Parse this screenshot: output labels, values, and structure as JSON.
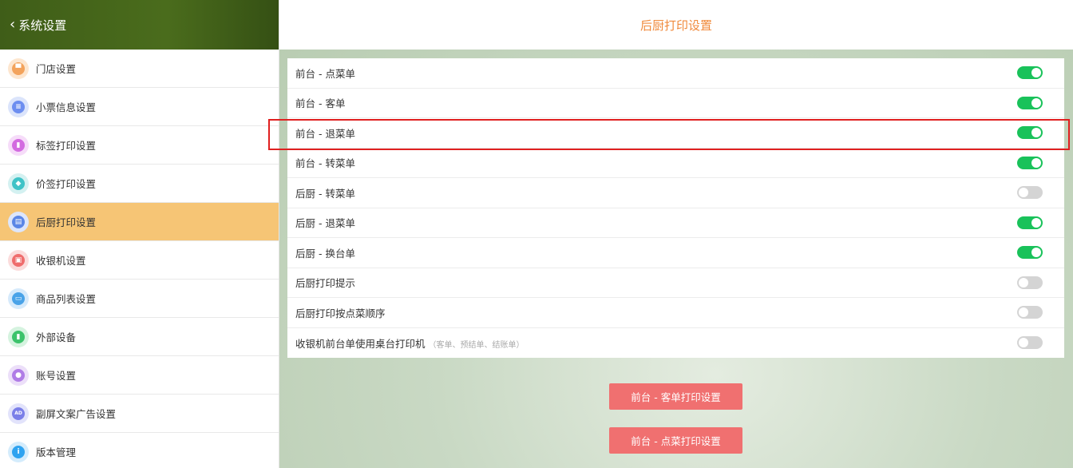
{
  "sidebar": {
    "title": "系统设置",
    "items": [
      {
        "label": "门店设置",
        "icon": "store-icon",
        "color": "#f3a35c",
        "bg": "#fde6cf"
      },
      {
        "label": "小票信息设置",
        "icon": "receipt-icon",
        "color": "#6d8ef0",
        "bg": "#dbe4fb"
      },
      {
        "label": "标签打印设置",
        "icon": "bookmark-icon",
        "color": "#d36be0",
        "bg": "#f6dcf9"
      },
      {
        "label": "价签打印设置",
        "icon": "price-tag-icon",
        "color": "#3ec3c7",
        "bg": "#d4f1f1"
      },
      {
        "label": "后厨打印设置",
        "icon": "printer-icon",
        "color": "#5b86e6",
        "bg": "#dde6fb"
      },
      {
        "label": "收银机设置",
        "icon": "cash-register-icon",
        "color": "#ef6d6d",
        "bg": "#fbdcdc"
      },
      {
        "label": "商品列表设置",
        "icon": "product-list-icon",
        "color": "#4aa3e8",
        "bg": "#d6eafb"
      },
      {
        "label": "外部设备",
        "icon": "device-icon",
        "color": "#3cc36b",
        "bg": "#d5f3df"
      },
      {
        "label": "账号设置",
        "icon": "user-icon",
        "color": "#b07ce6",
        "bg": "#ecdff9"
      },
      {
        "label": "副屏文案广告设置",
        "icon": "ad-icon",
        "color": "#7b7fe8",
        "bg": "#e2e3fb"
      },
      {
        "label": "版本管理",
        "icon": "info-icon",
        "color": "#2fa3f0",
        "bg": "#d4ecfc"
      }
    ],
    "active_index": 4
  },
  "main": {
    "title": "后厨打印设置",
    "settings": [
      {
        "label": "前台 - 点菜单",
        "hint": "",
        "on": true
      },
      {
        "label": "前台 - 客单",
        "hint": "",
        "on": true
      },
      {
        "label": "前台 - 退菜单",
        "hint": "",
        "on": true
      },
      {
        "label": "前台 - 转菜单",
        "hint": "",
        "on": true
      },
      {
        "label": "后厨 - 转菜单",
        "hint": "",
        "on": false
      },
      {
        "label": "后厨 - 退菜单",
        "hint": "",
        "on": true
      },
      {
        "label": "后厨 - 换台单",
        "hint": "",
        "on": true
      },
      {
        "label": "后厨打印提示",
        "hint": "",
        "on": false
      },
      {
        "label": "后厨打印按点菜顺序",
        "hint": "",
        "on": false
      },
      {
        "label": "收银机前台单使用桌台打印机",
        "hint": "（客单、预结单、结账单）",
        "on": false
      }
    ],
    "buttons": {
      "guest_bill": "前台 - 客单打印设置",
      "order_bill": "前台 - 点菜打印设置"
    }
  },
  "colors": {
    "accent_title": "#f08a3c",
    "toggle_on": "#19c25a",
    "button": "#f07070",
    "active_item": "#f6c575",
    "highlight_box": "#e02020"
  }
}
